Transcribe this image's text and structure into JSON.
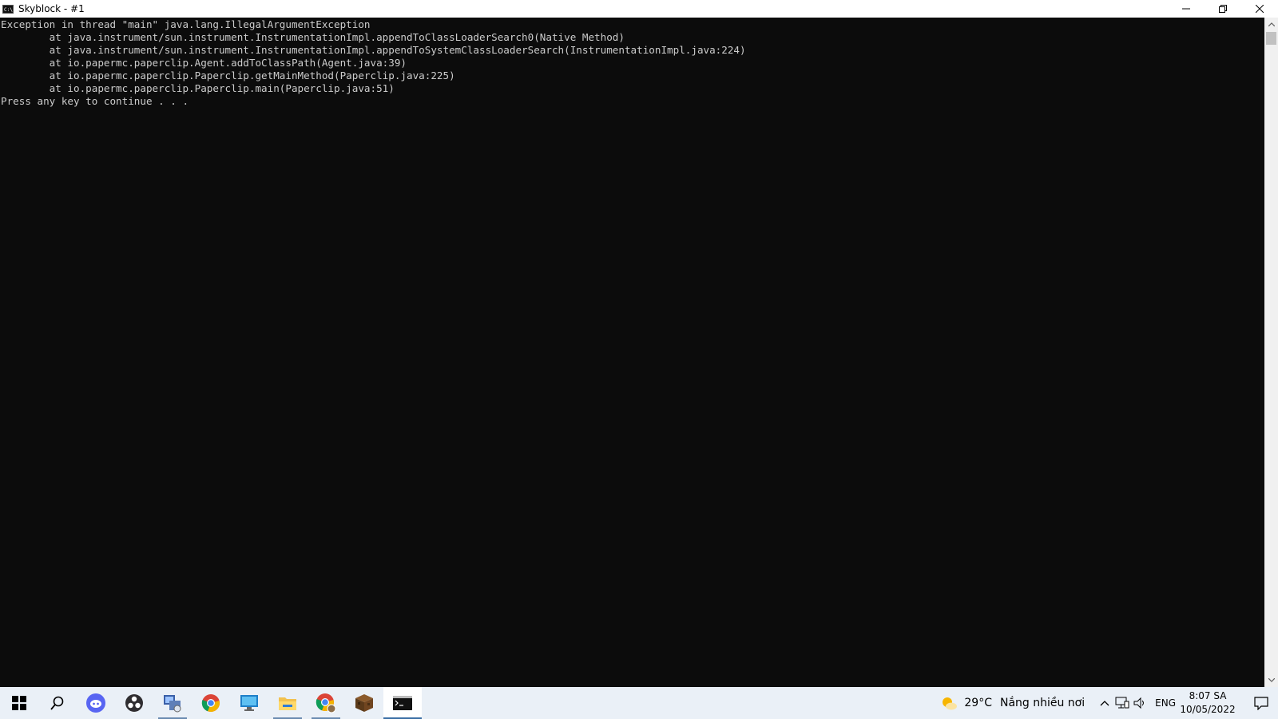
{
  "window": {
    "title": "Skyblock - #1",
    "icon_text": "C:\\"
  },
  "console": {
    "lines": [
      "Exception in thread \"main\" java.lang.IllegalArgumentException",
      "        at java.instrument/sun.instrument.InstrumentationImpl.appendToClassLoaderSearch0(Native Method)",
      "        at java.instrument/sun.instrument.InstrumentationImpl.appendToSystemClassLoaderSearch(InstrumentationImpl.java:224)",
      "        at io.papermc.paperclip.Agent.addToClassPath(Agent.java:39)",
      "        at io.papermc.paperclip.Paperclip.getMainMethod(Paperclip.java:225)",
      "        at io.papermc.paperclip.Paperclip.main(Paperclip.java:51)",
      "Press any key to continue . . ."
    ],
    "background": "#0c0c0c",
    "foreground": "#cccccc"
  },
  "taskbar": {
    "apps": [
      "start-icon",
      "search-icon",
      "discord-icon",
      "obs-icon",
      "network-app-icon",
      "chrome-icon",
      "remote-desktop-icon",
      "file-explorer-icon",
      "chrome-profile-icon",
      "minecraft-icon",
      "command-prompt-icon"
    ],
    "weather": {
      "temp": "29°C",
      "description": "Nắng nhiều nơi"
    },
    "language": "ENG",
    "time": "8:07 SA",
    "date": "10/05/2022"
  }
}
